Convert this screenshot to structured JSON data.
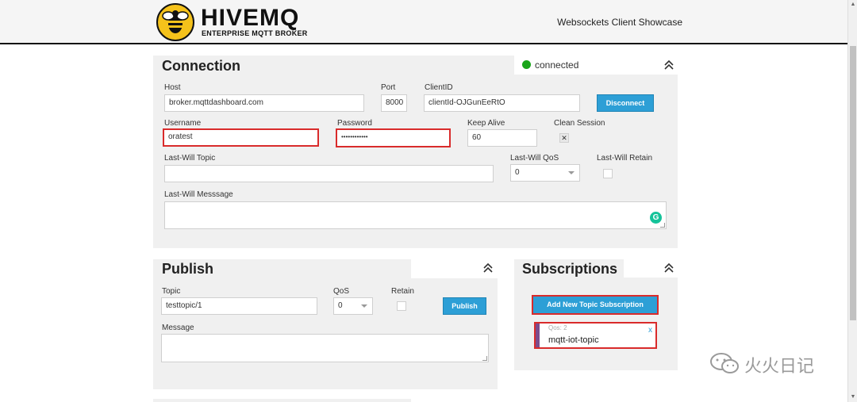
{
  "header": {
    "brand_name": "HIVEMQ",
    "brand_tagline": "ENTERPRISE MQTT BROKER",
    "page_title": "Websockets Client Showcase"
  },
  "connection": {
    "title": "Connection",
    "status": "connected",
    "status_color": "#1aa51a",
    "host_label": "Host",
    "host_value": "broker.mqttdashboard.com",
    "port_label": "Port",
    "port_value": "8000",
    "clientid_label": "ClientID",
    "clientid_value": "clientId-OJGunEeRtO",
    "disconnect_label": "Disconnect",
    "username_label": "Username",
    "username_value": "oratest",
    "password_label": "Password",
    "password_value": "••••••••••••",
    "keepalive_label": "Keep Alive",
    "keepalive_value": "60",
    "clean_session_label": "Clean Session",
    "clean_session_mark": "✕",
    "lastwill_topic_label": "Last-Will Topic",
    "lastwill_topic_value": "",
    "lastwill_qos_label": "Last-Will QoS",
    "lastwill_qos_value": "0",
    "lastwill_retain_label": "Last-Will Retain",
    "lastwill_message_label": "Last-Will Messsage",
    "lastwill_message_value": ""
  },
  "publish": {
    "title": "Publish",
    "topic_label": "Topic",
    "topic_value": "testtopic/1",
    "qos_label": "QoS",
    "qos_value": "0",
    "retain_label": "Retain",
    "publish_label": "Publish",
    "message_label": "Message",
    "message_value": ""
  },
  "subscriptions": {
    "title": "Subscriptions",
    "add_label": "Add New Topic Subscription",
    "items": [
      {
        "qos": "Qos: 2",
        "topic": "mqtt-iot-topic",
        "close": "x"
      }
    ]
  },
  "watermark": "火火日记",
  "colors": {
    "accent": "#2d9fd6",
    "highlight": "#d92b2b",
    "panel_bg": "#f0f0f0",
    "logo_yellow": "#f5c21b",
    "subscription_stripe": "#7b4b8c"
  },
  "icons": {
    "collapse": "double-chevron-up-icon",
    "grammarly": "grammarly-icon",
    "logo": "bee-logo-icon",
    "watermark": "wechat-icon"
  }
}
